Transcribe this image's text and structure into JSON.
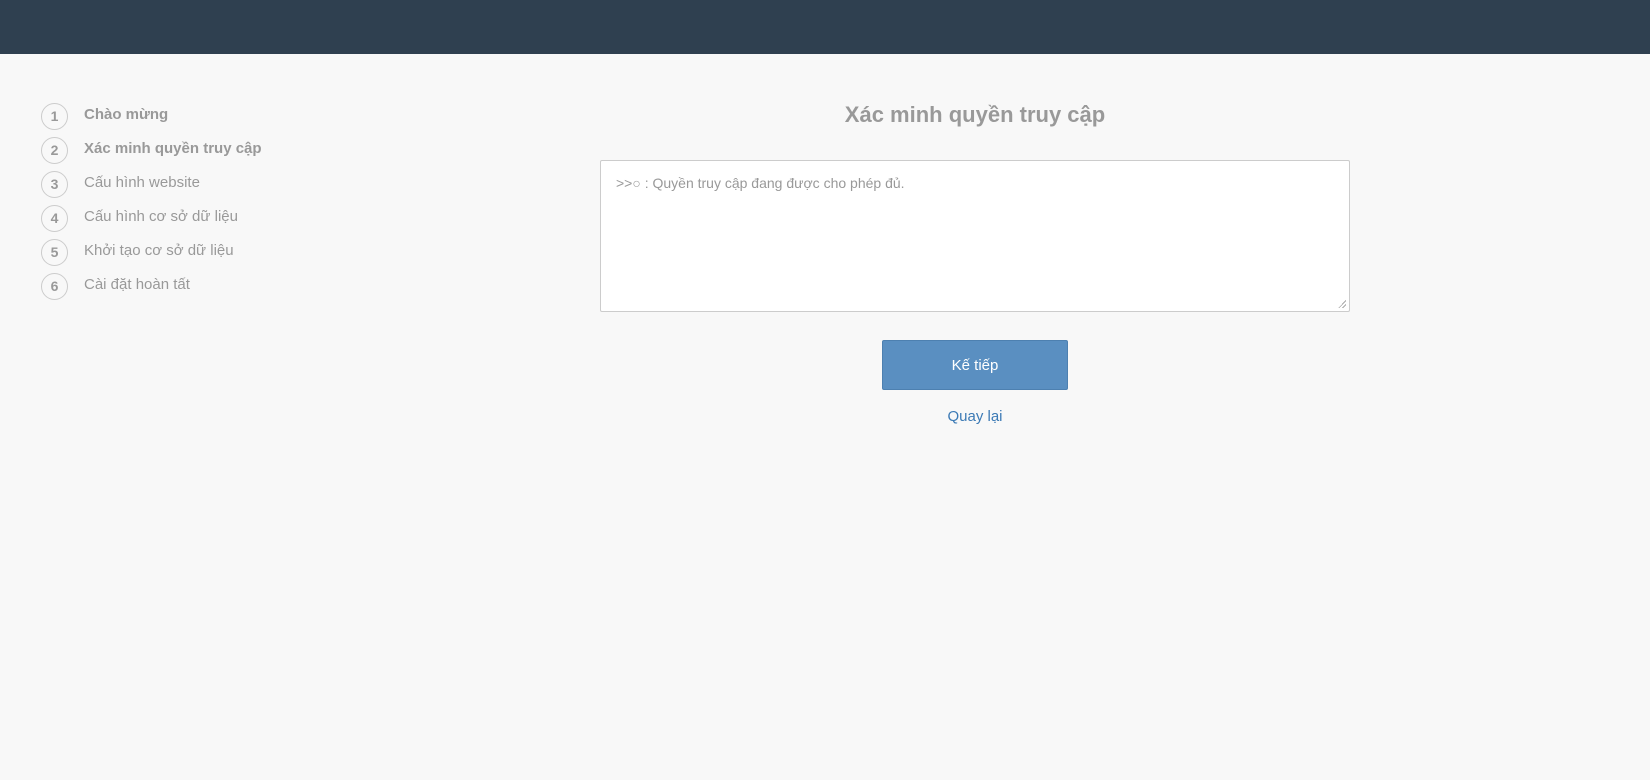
{
  "steps": [
    {
      "number": "1",
      "label": "Chào mừng"
    },
    {
      "number": "2",
      "label": "Xác minh quyền truy cập"
    },
    {
      "number": "3",
      "label": "Cấu hình website"
    },
    {
      "number": "4",
      "label": "Cấu hình cơ sở dữ liệu"
    },
    {
      "number": "5",
      "label": "Khởi tạo cơ sở dữ liệu"
    },
    {
      "number": "6",
      "label": "Cài đặt hoàn tất"
    }
  ],
  "main": {
    "title": "Xác minh quyền truy cập",
    "log_text": ">>○ : Quyền truy cập đang được cho phép đủ.",
    "next_label": "Kế tiếp",
    "back_label": "Quay lại"
  },
  "colors": {
    "topbar": "#2f4050",
    "accent": "#5a8fc1",
    "link": "#3c7ab5"
  }
}
